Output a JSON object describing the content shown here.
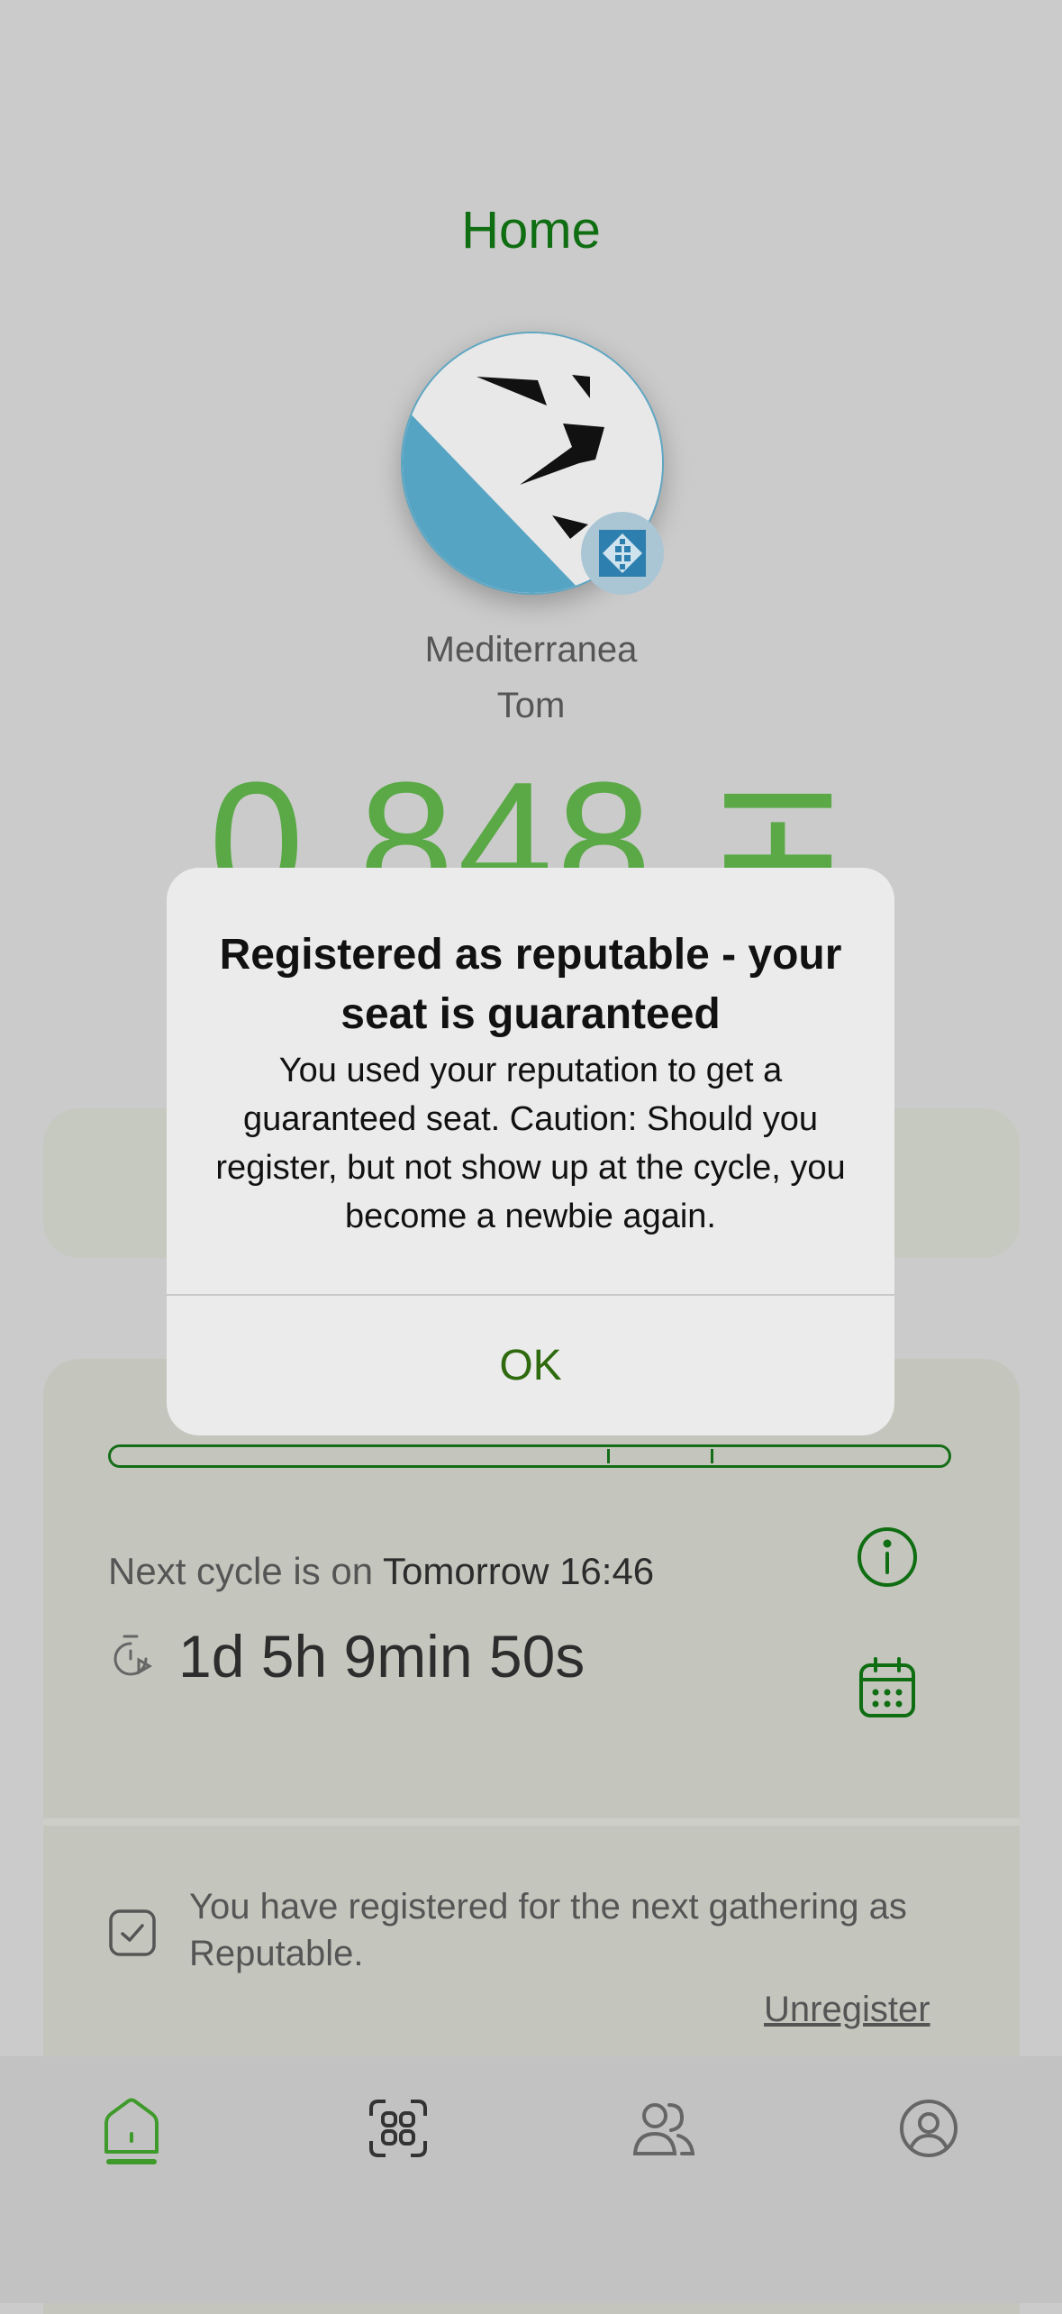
{
  "header": {
    "title": "Home"
  },
  "profile": {
    "name_line1": "Mediterranea",
    "name_line2": "Tom",
    "balance": "0.848 ∓"
  },
  "cycle": {
    "label": "Next cycle is on",
    "date": "Tomorrow 16:46",
    "countdown": "1d 5h 9min 50s"
  },
  "registration": {
    "text": "You have registered for the next gathering as Reputable.",
    "unregister_label": "Unregister"
  },
  "dialog": {
    "title": "Registered as reputable - your seat is guaranteed",
    "message": "You used your reputation to get a guaranteed seat. Caution: Should you register, but not show up at the cycle, you become a newbie again.",
    "ok_label": "OK"
  },
  "tabs": [
    {
      "icon": "home-icon",
      "active": true
    },
    {
      "icon": "scan-icon",
      "active": false
    },
    {
      "icon": "contacts-icon",
      "active": false
    },
    {
      "icon": "profile-icon",
      "active": false
    }
  ],
  "colors": {
    "accent": "#0f6d12",
    "balance": "#5aa946",
    "dialog_ok": "#2f6a0e"
  }
}
